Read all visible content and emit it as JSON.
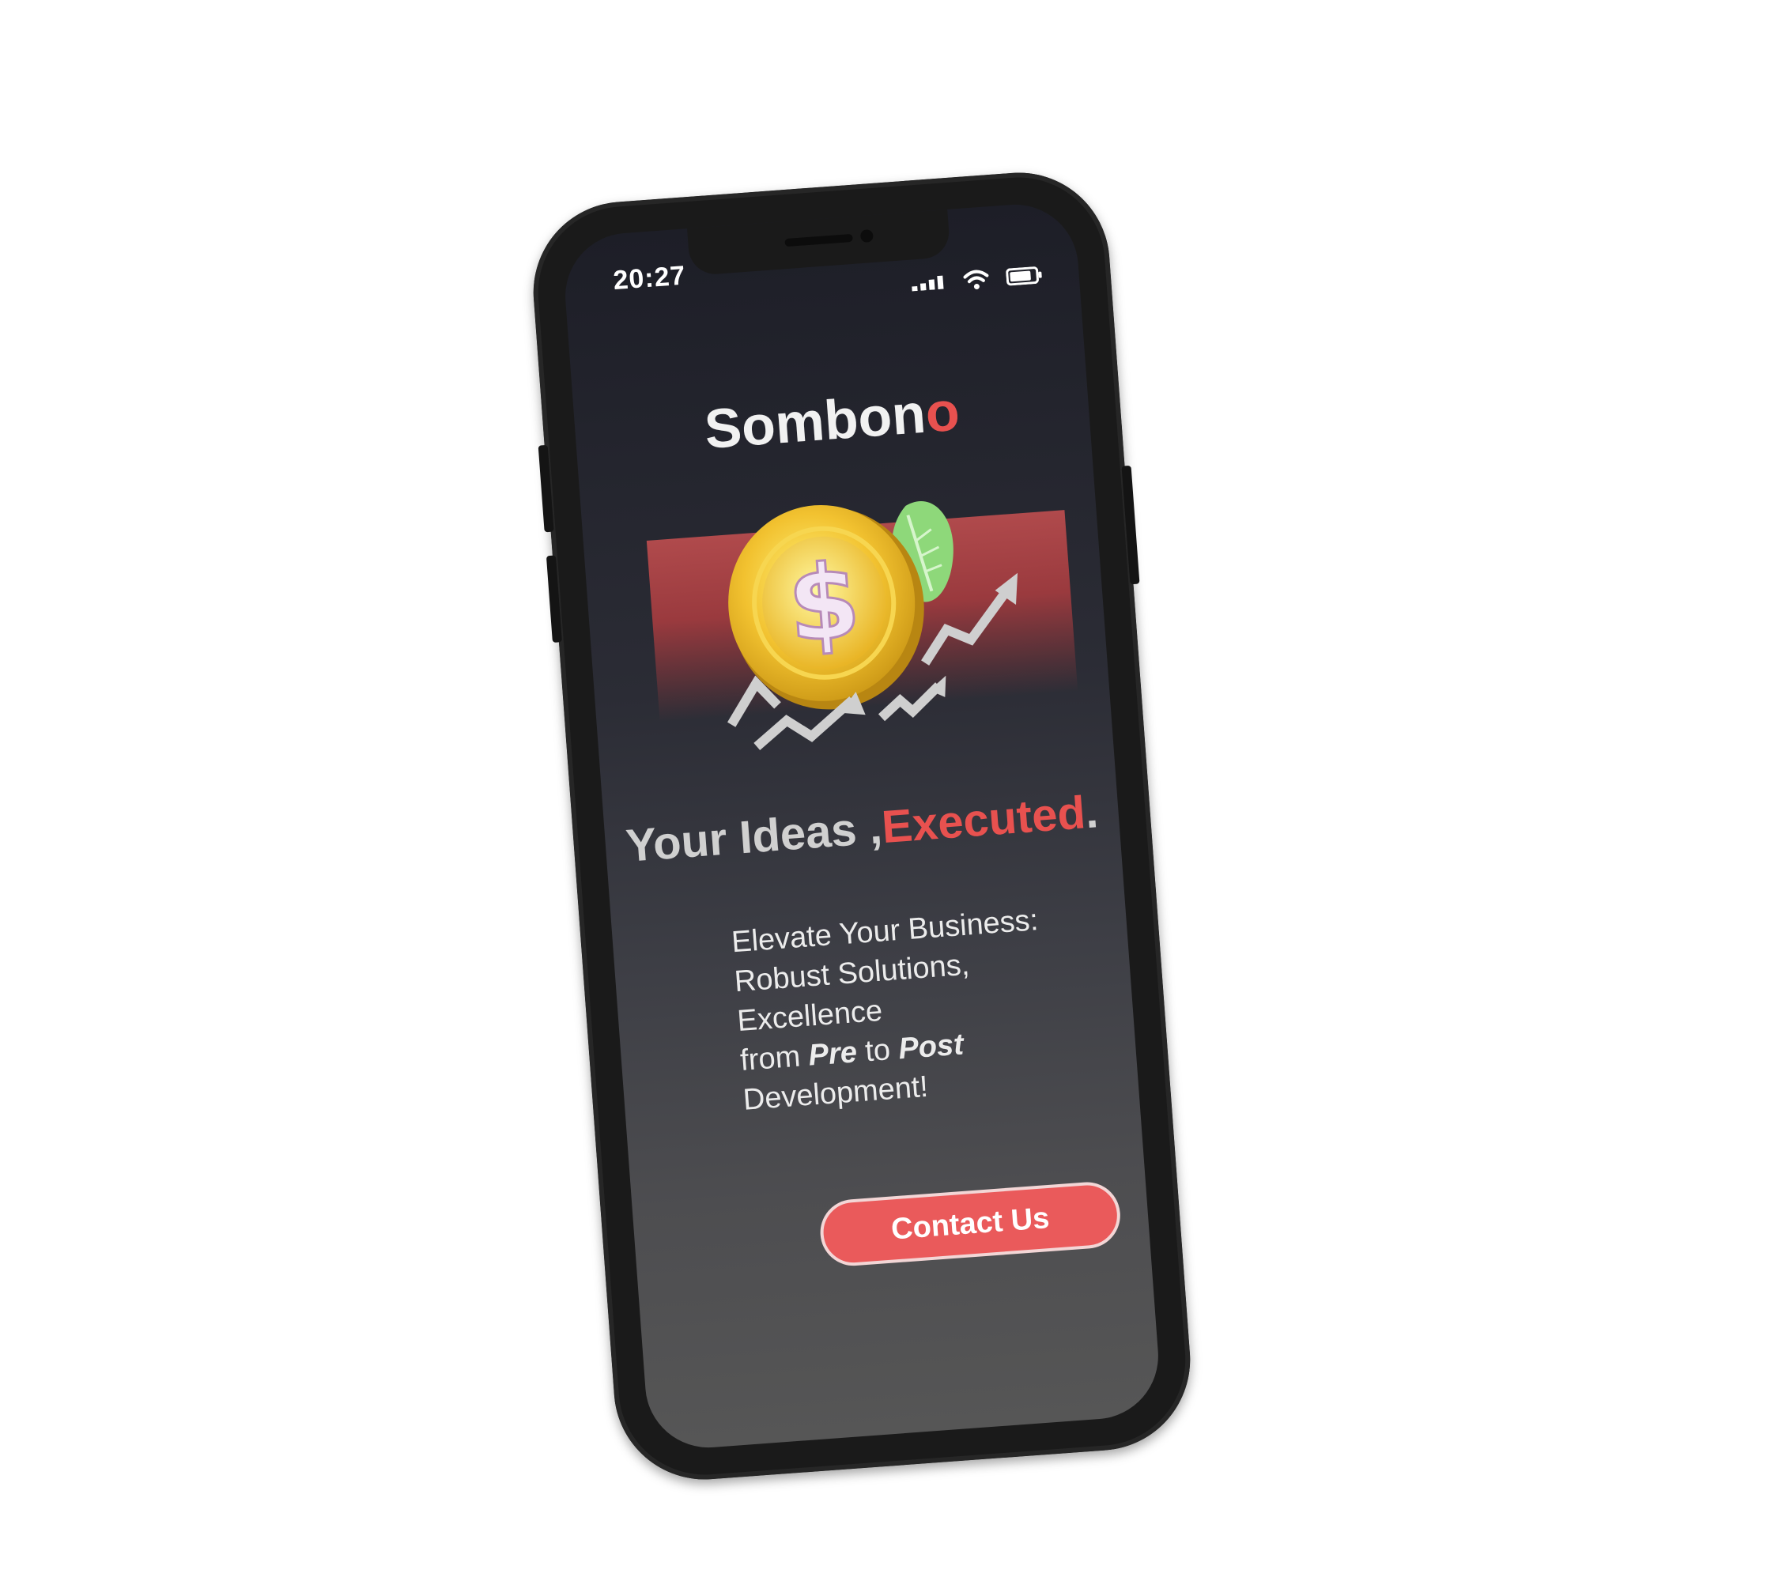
{
  "status_bar": {
    "time": "20:27",
    "icons": [
      "signal-icon",
      "wifi-icon",
      "battery-icon"
    ]
  },
  "brand": {
    "name_main": "Sombon",
    "name_accent": "o"
  },
  "hero": {
    "illustration": "dollar-coin-with-growth-arrows"
  },
  "headline": {
    "part1": "Your Ideas ,",
    "part2": "Executed",
    "part3": "."
  },
  "body": {
    "lead": "Elevate Your Business:",
    "line2": "Robust Solutions, Excellence",
    "line3_pre": "from ",
    "line3_bold1": "Pre",
    "line3_mid": " to ",
    "line3_bold2": "Post",
    "line4": "Development!"
  },
  "cta": {
    "label": "Contact Us"
  },
  "colors": {
    "accent": "#e8514f",
    "button": "#ea5a5b",
    "coin": "#f2c230",
    "leaf": "#8ed87a"
  }
}
